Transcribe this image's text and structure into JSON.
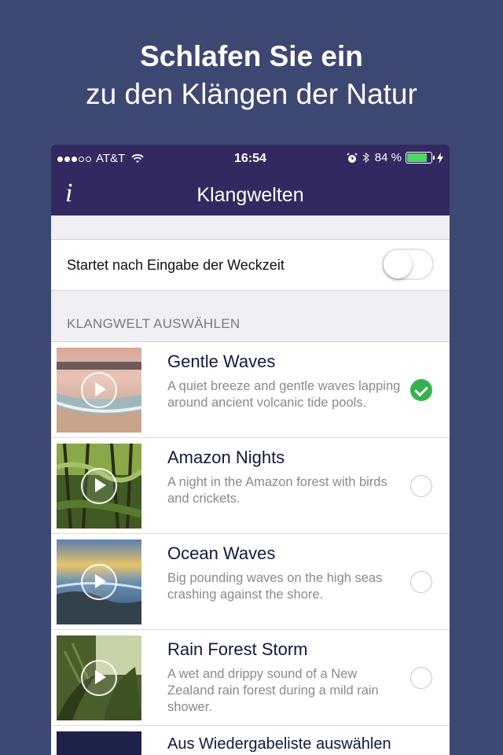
{
  "promo": {
    "title": "Schlafen Sie ein",
    "subtitle": "zu den Klängen der Natur"
  },
  "status_bar": {
    "carrier": "AT&T",
    "time": "16:54",
    "battery": "84 %",
    "battery_level": 0.84,
    "icons": [
      "signal-dots-icon",
      "wifi-icon",
      "alarm-icon",
      "bluetooth-icon",
      "battery-icon",
      "charging-bolt-icon"
    ]
  },
  "nav": {
    "title": "Klangwelten",
    "info_label": "i"
  },
  "settings": {
    "toggle_label": "Startet nach Eingabe der Weckzeit",
    "toggle_on": false
  },
  "section": {
    "header": "KLANGWELT AUSWÄHLEN"
  },
  "soundscapes": [
    {
      "title": "Gentle Waves",
      "description": "A quiet breeze and gentle waves lapping around ancient volcanic tide pools.",
      "selected": true
    },
    {
      "title": "Amazon Nights",
      "description": "A night in the Amazon forest with birds and crickets.",
      "selected": false
    },
    {
      "title": "Ocean Waves",
      "description": "Big pounding waves on the high seas crashing against the shore.",
      "selected": false
    },
    {
      "title": "Rain Forest Storm",
      "description": "A wet and drippy sound of a New Zealand rain forest during a mild rain shower.",
      "selected": false
    }
  ],
  "playlist": {
    "label": "Aus Wiedergabeliste auswählen"
  },
  "colors": {
    "background": "#3d4872",
    "navbar": "#312960",
    "check_green": "#34b24f",
    "battery_green": "#4cd964"
  }
}
